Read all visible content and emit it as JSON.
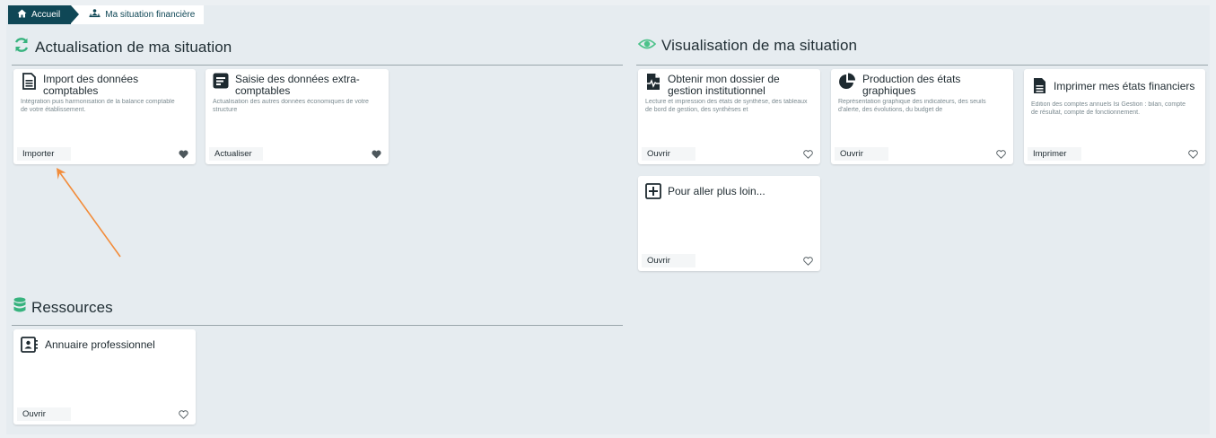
{
  "breadcrumb": {
    "home_label": "Accueil",
    "current_label": "Ma situation financière"
  },
  "sections": {
    "actualisation": {
      "title": "Actualisation de ma situation"
    },
    "visualisation": {
      "title": "Visualisation de ma situation"
    },
    "ressources": {
      "title": "Ressources"
    }
  },
  "cards": {
    "import": {
      "title": "Import des données comptables",
      "desc": "Intégration puis harmonisation de la balance comptable de votre établissement.",
      "button": "Importer",
      "favorite": true
    },
    "saisie": {
      "title": "Saisie des données extra-comptables",
      "desc": "Actualisation des autres données économiques de votre structure",
      "button": "Actualiser",
      "favorite": true
    },
    "dossier": {
      "title": "Obtenir mon dossier de gestion institutionnel",
      "desc": "Lecture et impression des états de synthèse, des tableaux de bord de gestion, des synthèses et",
      "button": "Ouvrir",
      "favorite": false
    },
    "production": {
      "title": "Production des états graphiques",
      "desc": "Représentation graphique des indicateurs, des seuils d'alerte, des évolutions, du budget de",
      "button": "Ouvrir",
      "favorite": false
    },
    "imprimer": {
      "title": "Imprimer mes états financiers",
      "desc": "Edition des comptes annuels Isi Gestion : bilan, compte de résultat, compte de fonctionnement.",
      "button": "Imprimer",
      "favorite": false
    },
    "plusloin": {
      "title": "Pour aller plus loin...",
      "desc": "",
      "button": "Ouvrir",
      "favorite": false
    },
    "annuaire": {
      "title": "Annuaire professionnel",
      "desc": "",
      "button": "Ouvrir",
      "favorite": false
    }
  },
  "colors": {
    "brand_dark": "#0f4756",
    "accent_green": "#37b37e",
    "eye_green": "#4cc28a",
    "arrow_orange": "#f28c3a"
  },
  "icons": {
    "home": "home-icon",
    "situation": "finance-person-icon",
    "refresh": "refresh-icon",
    "eye": "eye-icon",
    "database": "database-icon"
  }
}
